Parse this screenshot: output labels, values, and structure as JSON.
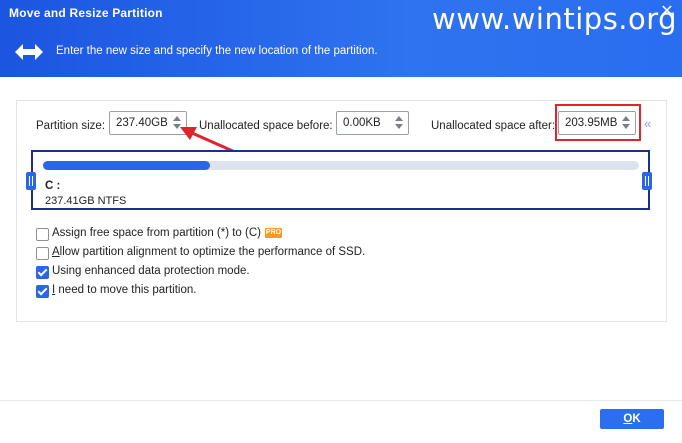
{
  "window": {
    "title": "Move and Resize Partition",
    "close_glyph": "✕",
    "watermark": "www.wintips.org",
    "subtitle": "Enter the new size and specify the new location of the partition.",
    "header_icon": "resize-arrows-icon",
    "accent_color": "#2a66e8"
  },
  "fields": {
    "partition_size_label": "Partition size:",
    "partition_size_value": "237.40GB",
    "unalloc_before_label": "Unallocated space before:",
    "unalloc_before_value": "0.00KB",
    "unalloc_after_label": "Unallocated space after:",
    "unalloc_after_value": "203.95MB",
    "collapse_glyph": "«"
  },
  "partition": {
    "letter": "C :",
    "info": "237.41GB NTFS",
    "used_fraction": 0.28
  },
  "options": [
    {
      "pre": "Assign free space from partition (*) to (C)",
      "u": "",
      "post": "",
      "checked": false,
      "badge": "PRO"
    },
    {
      "pre": "",
      "u": "A",
      "post": "llow partition alignment to optimize the performance of SSD.",
      "checked": false
    },
    {
      "pre": "Using enhanced data protection mode.",
      "u": "",
      "post": "",
      "checked": true
    },
    {
      "pre": "",
      "u": "I",
      "post": " need to move this partition.",
      "checked": true
    }
  ],
  "footer": {
    "ok_u": "O",
    "ok_rest": "K"
  }
}
